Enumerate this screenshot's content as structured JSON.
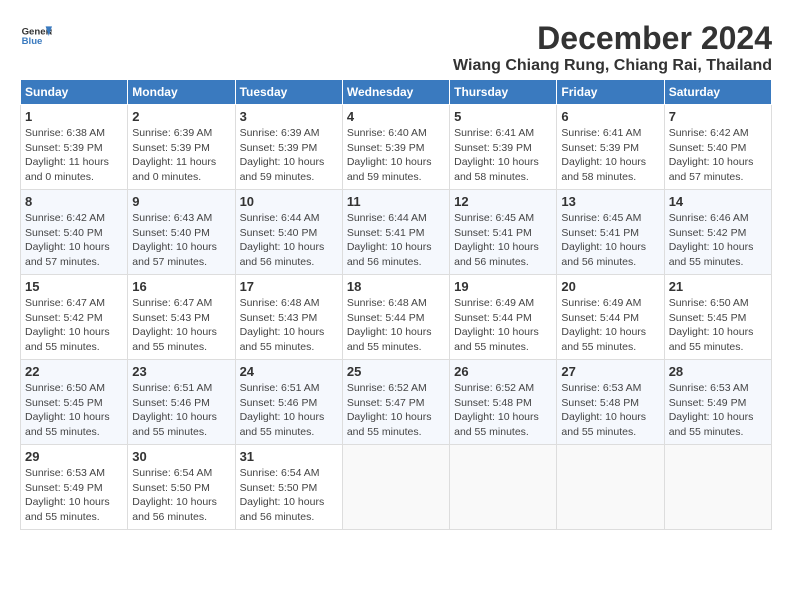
{
  "header": {
    "logo_line1": "General",
    "logo_line2": "Blue",
    "month": "December 2024",
    "location": "Wiang Chiang Rung, Chiang Rai, Thailand"
  },
  "days_of_week": [
    "Sunday",
    "Monday",
    "Tuesday",
    "Wednesday",
    "Thursday",
    "Friday",
    "Saturday"
  ],
  "weeks": [
    [
      {
        "day": "1",
        "sunrise": "6:38 AM",
        "sunset": "5:39 PM",
        "daylight": "11 hours and 0 minutes."
      },
      {
        "day": "2",
        "sunrise": "6:39 AM",
        "sunset": "5:39 PM",
        "daylight": "11 hours and 0 minutes."
      },
      {
        "day": "3",
        "sunrise": "6:39 AM",
        "sunset": "5:39 PM",
        "daylight": "10 hours and 59 minutes."
      },
      {
        "day": "4",
        "sunrise": "6:40 AM",
        "sunset": "5:39 PM",
        "daylight": "10 hours and 59 minutes."
      },
      {
        "day": "5",
        "sunrise": "6:41 AM",
        "sunset": "5:39 PM",
        "daylight": "10 hours and 58 minutes."
      },
      {
        "day": "6",
        "sunrise": "6:41 AM",
        "sunset": "5:39 PM",
        "daylight": "10 hours and 58 minutes."
      },
      {
        "day": "7",
        "sunrise": "6:42 AM",
        "sunset": "5:40 PM",
        "daylight": "10 hours and 57 minutes."
      }
    ],
    [
      {
        "day": "8",
        "sunrise": "6:42 AM",
        "sunset": "5:40 PM",
        "daylight": "10 hours and 57 minutes."
      },
      {
        "day": "9",
        "sunrise": "6:43 AM",
        "sunset": "5:40 PM",
        "daylight": "10 hours and 57 minutes."
      },
      {
        "day": "10",
        "sunrise": "6:44 AM",
        "sunset": "5:40 PM",
        "daylight": "10 hours and 56 minutes."
      },
      {
        "day": "11",
        "sunrise": "6:44 AM",
        "sunset": "5:41 PM",
        "daylight": "10 hours and 56 minutes."
      },
      {
        "day": "12",
        "sunrise": "6:45 AM",
        "sunset": "5:41 PM",
        "daylight": "10 hours and 56 minutes."
      },
      {
        "day": "13",
        "sunrise": "6:45 AM",
        "sunset": "5:41 PM",
        "daylight": "10 hours and 56 minutes."
      },
      {
        "day": "14",
        "sunrise": "6:46 AM",
        "sunset": "5:42 PM",
        "daylight": "10 hours and 55 minutes."
      }
    ],
    [
      {
        "day": "15",
        "sunrise": "6:47 AM",
        "sunset": "5:42 PM",
        "daylight": "10 hours and 55 minutes."
      },
      {
        "day": "16",
        "sunrise": "6:47 AM",
        "sunset": "5:43 PM",
        "daylight": "10 hours and 55 minutes."
      },
      {
        "day": "17",
        "sunrise": "6:48 AM",
        "sunset": "5:43 PM",
        "daylight": "10 hours and 55 minutes."
      },
      {
        "day": "18",
        "sunrise": "6:48 AM",
        "sunset": "5:44 PM",
        "daylight": "10 hours and 55 minutes."
      },
      {
        "day": "19",
        "sunrise": "6:49 AM",
        "sunset": "5:44 PM",
        "daylight": "10 hours and 55 minutes."
      },
      {
        "day": "20",
        "sunrise": "6:49 AM",
        "sunset": "5:44 PM",
        "daylight": "10 hours and 55 minutes."
      },
      {
        "day": "21",
        "sunrise": "6:50 AM",
        "sunset": "5:45 PM",
        "daylight": "10 hours and 55 minutes."
      }
    ],
    [
      {
        "day": "22",
        "sunrise": "6:50 AM",
        "sunset": "5:45 PM",
        "daylight": "10 hours and 55 minutes."
      },
      {
        "day": "23",
        "sunrise": "6:51 AM",
        "sunset": "5:46 PM",
        "daylight": "10 hours and 55 minutes."
      },
      {
        "day": "24",
        "sunrise": "6:51 AM",
        "sunset": "5:46 PM",
        "daylight": "10 hours and 55 minutes."
      },
      {
        "day": "25",
        "sunrise": "6:52 AM",
        "sunset": "5:47 PM",
        "daylight": "10 hours and 55 minutes."
      },
      {
        "day": "26",
        "sunrise": "6:52 AM",
        "sunset": "5:48 PM",
        "daylight": "10 hours and 55 minutes."
      },
      {
        "day": "27",
        "sunrise": "6:53 AM",
        "sunset": "5:48 PM",
        "daylight": "10 hours and 55 minutes."
      },
      {
        "day": "28",
        "sunrise": "6:53 AM",
        "sunset": "5:49 PM",
        "daylight": "10 hours and 55 minutes."
      }
    ],
    [
      {
        "day": "29",
        "sunrise": "6:53 AM",
        "sunset": "5:49 PM",
        "daylight": "10 hours and 55 minutes."
      },
      {
        "day": "30",
        "sunrise": "6:54 AM",
        "sunset": "5:50 PM",
        "daylight": "10 hours and 56 minutes."
      },
      {
        "day": "31",
        "sunrise": "6:54 AM",
        "sunset": "5:50 PM",
        "daylight": "10 hours and 56 minutes."
      },
      null,
      null,
      null,
      null
    ]
  ]
}
